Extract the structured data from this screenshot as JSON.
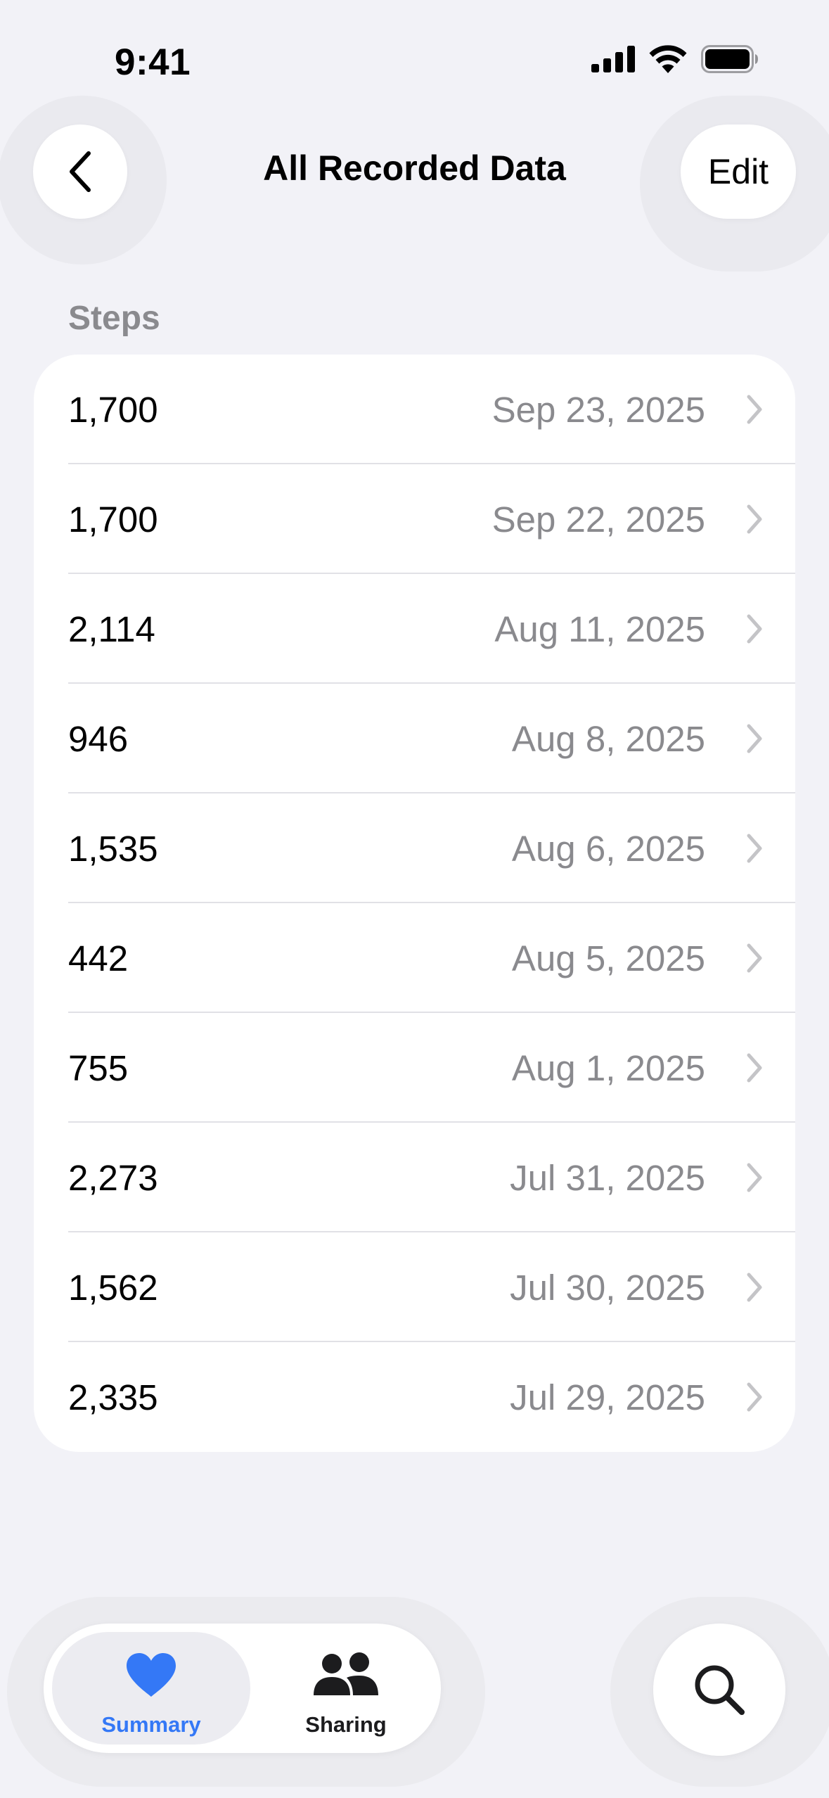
{
  "status_bar": {
    "time": "9:41"
  },
  "nav": {
    "title": "All Recorded Data",
    "edit_label": "Edit"
  },
  "section": {
    "header": "Steps"
  },
  "records": [
    {
      "value": "1,700",
      "date": "Sep 23, 2025"
    },
    {
      "value": "1,700",
      "date": "Sep 22, 2025"
    },
    {
      "value": "2,114",
      "date": "Aug 11, 2025"
    },
    {
      "value": "946",
      "date": "Aug 8, 2025"
    },
    {
      "value": "1,535",
      "date": "Aug 6, 2025"
    },
    {
      "value": "442",
      "date": "Aug 5, 2025"
    },
    {
      "value": "755",
      "date": "Aug 1, 2025"
    },
    {
      "value": "2,273",
      "date": "Jul 31, 2025"
    },
    {
      "value": "1,562",
      "date": "Jul 30, 2025"
    },
    {
      "value": "2,335",
      "date": "Jul 29, 2025"
    }
  ],
  "tabbar": {
    "tabs": [
      {
        "label": "Summary",
        "icon": "heart-icon",
        "selected": true
      },
      {
        "label": "Sharing",
        "icon": "people-icon",
        "selected": false
      }
    ],
    "search_icon": "magnifying-glass-icon"
  },
  "colors": {
    "accent": "#3478f6",
    "background": "#f2f2f7",
    "secondary_text": "#8a8a8e"
  }
}
